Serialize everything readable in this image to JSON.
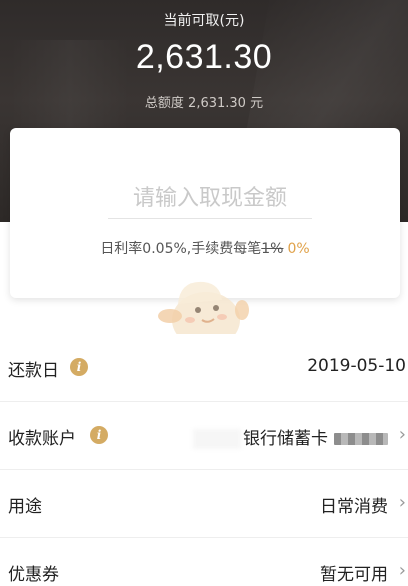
{
  "header": {
    "available_label": "当前可取(元)",
    "available_amount": "2,631.30",
    "total_limit": "总额度 2,631.30 元"
  },
  "withdraw_card": {
    "amount_placeholder": "请输入取现金额",
    "rate_prefix": "日利率0.05%,手续费每笔",
    "fee_original": "1%",
    "fee_promo": "0%"
  },
  "rows": {
    "repay_date": {
      "label": "还款日",
      "value": "2019-05-10",
      "icon": "info-icon"
    },
    "account": {
      "label": "收款账户",
      "value": "银行储蓄卡",
      "icon": "info-icon"
    },
    "purpose": {
      "label": "用途",
      "value": "日常消费"
    },
    "coupon": {
      "label": "优惠券",
      "value": "暂无可用"
    }
  },
  "colors": {
    "header_bg": "#2f2b2a",
    "accent": "#d4ab63",
    "promo": "#e0a24a"
  }
}
